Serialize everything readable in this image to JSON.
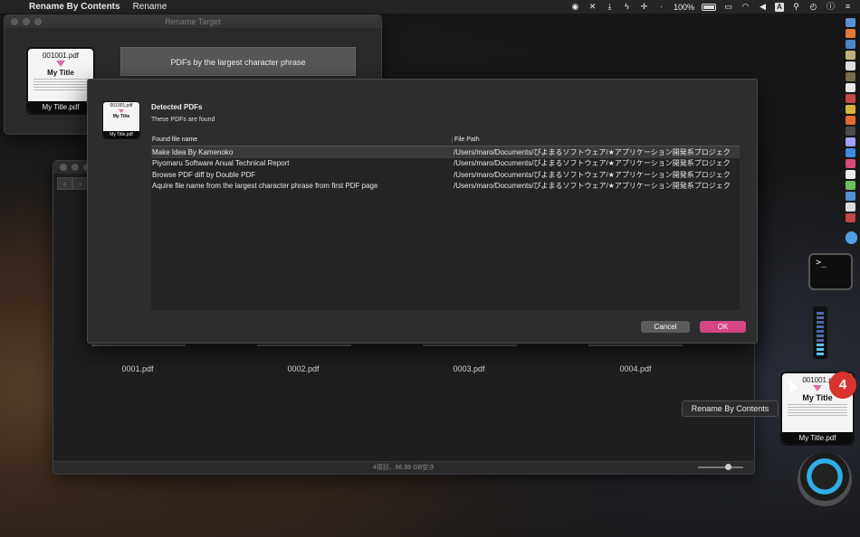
{
  "menubar": {
    "app_name": "Rename By Contents",
    "menu_item": "Rename",
    "battery": "100%"
  },
  "target_window": {
    "title": "Rename Target",
    "thumb": {
      "filename": "001001.pdf",
      "title": "My Title",
      "caption": "My Title.pdf"
    },
    "phrase_button": "PDFs by the largest character phrase"
  },
  "files_window": {
    "files": [
      "0001.pdf",
      "0002.pdf",
      "0003.pdf",
      "0004.pdf"
    ],
    "status": "4項目、96.88 GB空き"
  },
  "dialog": {
    "thumb": {
      "filename": "001001.pdf",
      "title": "My Title",
      "caption": "My Title.pdf"
    },
    "title": "Detected PDFs",
    "subtitle": "These PDFs are found",
    "columns": {
      "name": "Found file name",
      "path": "File Path"
    },
    "rows": [
      {
        "name": "Make Idea By Kamenoko",
        "path": "/Users/maro/Documents/ぴよまるソフトウェア/★アプリケーション開発系プロジェク"
      },
      {
        "name": "Piyomaru Software Anual Technical Report",
        "path": "/Users/maro/Documents/ぴよまるソフトウェア/★アプリケーション開発系プロジェク"
      },
      {
        "name": "Browse PDF diff by Double PDF",
        "path": "/Users/maro/Documents/ぴよまるソフトウェア/★アプリケーション開発系プロジェク"
      },
      {
        "name": "Aquire file name from the largest character phrase from first PDF page",
        "path": "/Users/maro/Documents/ぴよまるソフトウェア/★アプリケーション開発系プロジェク"
      }
    ],
    "cancel_label": "Cancel",
    "ok_label": "OK"
  },
  "dock": {
    "terminal_prompt": ">_",
    "tooltip": "Rename By Contents",
    "badge": "4",
    "app_thumb": {
      "filename": "001001.p",
      "title": "My Title",
      "caption": "My Title.pdf"
    }
  }
}
